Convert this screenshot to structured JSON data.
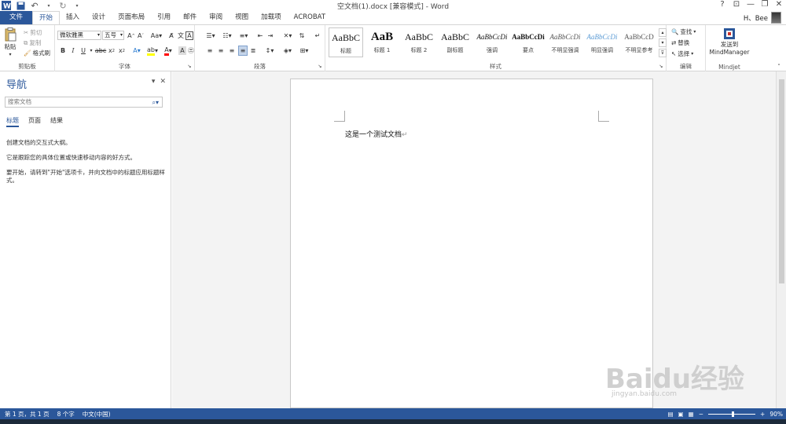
{
  "titlebar": {
    "title": "空文档(1).docx [兼容模式] - Word",
    "help": "?",
    "minimize": "—",
    "restore": "❐",
    "close": "✕",
    "ribbon_opts": "⊡"
  },
  "tabs": [
    "文件",
    "开始",
    "插入",
    "设计",
    "页面布局",
    "引用",
    "邮件",
    "审阅",
    "视图",
    "加载项",
    "ACROBAT"
  ],
  "user": {
    "name": "H、Bee"
  },
  "ribbon": {
    "clipboard": {
      "label": "剪贴板",
      "paste": "粘贴",
      "cut": "剪切",
      "copy": "复制",
      "format_painter": "格式刷"
    },
    "font": {
      "label": "字体",
      "font_name": "微软雅黑",
      "font_size": "五号"
    },
    "paragraph": {
      "label": "段落"
    },
    "styles": {
      "label": "样式",
      "items": [
        {
          "sample": "AaBbC",
          "name": "标题"
        },
        {
          "sample": "AaB",
          "name": "标题 1"
        },
        {
          "sample": "AaBbC",
          "name": "标题 2"
        },
        {
          "sample": "AaBbC",
          "name": "副标题"
        },
        {
          "sample": "AaBbCcDi",
          "name": "强调"
        },
        {
          "sample": "AaBbCcDi",
          "name": "要点"
        },
        {
          "sample": "AaBbCcDi",
          "name": "不明显强调"
        },
        {
          "sample": "AaBbCcDi",
          "name": "明显强调"
        },
        {
          "sample": "AaBbCcD",
          "name": "不明显参考"
        }
      ]
    },
    "editing": {
      "label": "编辑",
      "find": "查找",
      "replace": "替换",
      "select": "选择"
    },
    "mindjet": {
      "label": "Mindjet",
      "send1": "发送到",
      "send2": "MindManager"
    }
  },
  "nav": {
    "title": "导航",
    "search_placeholder": "搜索文档",
    "tabs": [
      "标题",
      "页面",
      "结果"
    ],
    "text": [
      "创建文档的交互式大纲。",
      "它是跟踪您的具体位置或快速移动内容的好方式。",
      "要开始，请转到\"开始\"选项卡，并向文档中的标题应用标题样式。"
    ]
  },
  "document": {
    "body": "这是一个测试文档"
  },
  "status": {
    "page": "第 1 页，共 1 页",
    "words": "8 个字",
    "language": "中文(中国)",
    "zoom": "90%"
  },
  "watermark": {
    "logo": "Baidu经验",
    "url": "jingyan.baidu.com"
  },
  "colors": {
    "brand": "#2b579a",
    "highlight": "#ffff00",
    "font_color": "#ff0000"
  }
}
